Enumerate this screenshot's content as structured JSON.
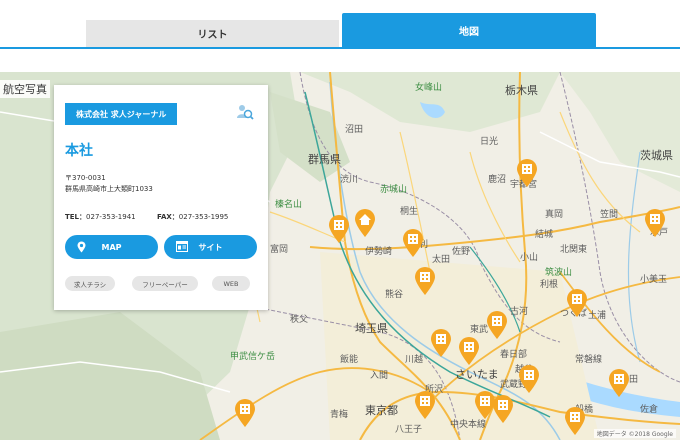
{
  "tabs": {
    "list_label": "リスト",
    "map_label": "地図"
  },
  "map": {
    "aerial_label": "航空写真",
    "attribution": "地図データ ©2018 Google",
    "labels": {
      "gunma": "群馬県",
      "tochigi": "栃木県",
      "ibaraki": "茨城県",
      "saitama_pref": "埼玉県",
      "saitama_city": "さいたま",
      "tokyo": "東京都",
      "tokorozawa": "所沢",
      "hachioji": "八王子",
      "ashikaga": "足利",
      "nikko": "日光",
      "oyama": "小山",
      "koga": "古河",
      "tsukuba": "つくば",
      "tsuchiura": "土浦",
      "mito": "水戸",
      "utsunomiya": "宇都宮",
      "kanuma": "鹿沼",
      "moka": "真岡",
      "isesaki": "伊勢崎",
      "kiryu": "桐生",
      "ota": "太田",
      "kumagaya": "熊谷",
      "chichibu": "秩父",
      "numata": "沼田",
      "shibukawa": "渋川",
      "tomioka": "富岡",
      "mt_nyoho": "女峰山",
      "mt_akagi": "赤城山",
      "mt_haruna": "榛名山",
      "mt_tsukuba": "筑波山",
      "mt_kobushi": "甲武信ケ岳",
      "ome": "青梅",
      "iruma": "入間",
      "kawagoe": "川越",
      "hanno": "飯能",
      "sano": "佐野",
      "yuki": "結城",
      "kasama": "笠間",
      "omitama": "小美玉",
      "sakura": "佐倉",
      "narita": "成田",
      "chuo_honsen": "中央本線",
      "joban": "常磐線",
      "tobu": "東武",
      "kitakanto": "北関東",
      "musashino": "武蔵野",
      "tone": "利根",
      "kasukabe": "春日部",
      "koshigaya": "越谷",
      "funabashi": "船橋"
    }
  },
  "card": {
    "company_name": "株式会社 求人ジャーナル",
    "office_name": "本社",
    "postal": "〒370-0031",
    "address": "群馬県高崎市上大類町1033",
    "tel_label": "TEL：",
    "tel": "027-353-1941",
    "fax_label": "FAX：",
    "fax": "027-353-1995",
    "map_button": "MAP",
    "site_button": "サイト",
    "tags": [
      "求人チラシ",
      "フリーペーパー",
      "WEB"
    ]
  },
  "colors": {
    "accent": "#1a9ae0",
    "pin": "#f5a623",
    "map_bg": "#f1efe6"
  }
}
